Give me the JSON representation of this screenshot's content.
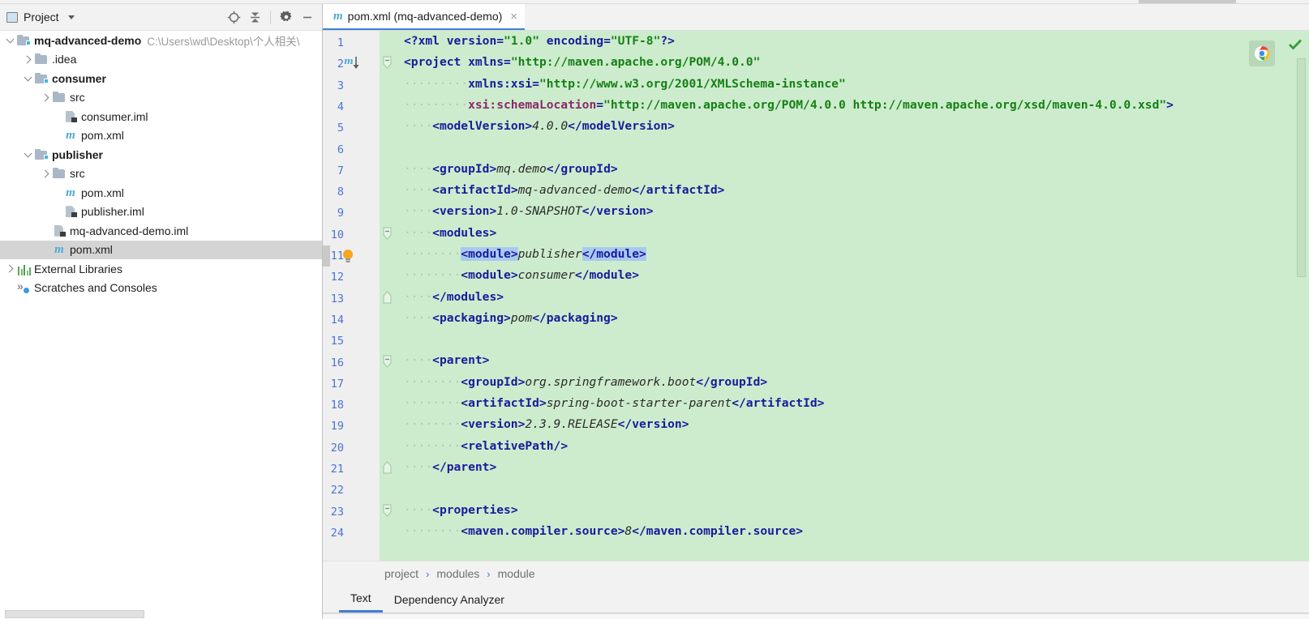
{
  "window": {
    "tool_window_title": "Project"
  },
  "toolbar": {
    "locate_icon": "locate-target-icon",
    "collapse_icon": "collapse-all-icon",
    "settings_icon": "gear-icon",
    "minimize_icon": "minimize-icon"
  },
  "project_tree": [
    {
      "label": "mq-advanced-demo",
      "path": "C:\\Users\\wd\\Desktop\\个人相关\\",
      "icon": "module-folder-icon",
      "twisty": "down",
      "indent": 0,
      "bold": true,
      "selected": false
    },
    {
      "label": ".idea",
      "path": "",
      "icon": "folder-icon",
      "twisty": "right",
      "indent": 1,
      "bold": false,
      "selected": false
    },
    {
      "label": "consumer",
      "path": "",
      "icon": "module-folder-icon",
      "twisty": "down",
      "indent": 1,
      "bold": true,
      "selected": false
    },
    {
      "label": "src",
      "path": "",
      "icon": "folder-icon",
      "twisty": "right",
      "indent": 2,
      "bold": false,
      "selected": false
    },
    {
      "label": "consumer.iml",
      "path": "",
      "icon": "iml-file-icon",
      "twisty": "none",
      "indent": 3,
      "bold": false,
      "selected": false
    },
    {
      "label": "pom.xml",
      "path": "",
      "icon": "maven-file-icon",
      "twisty": "none",
      "indent": 3,
      "bold": false,
      "selected": false
    },
    {
      "label": "publisher",
      "path": "",
      "icon": "module-folder-icon",
      "twisty": "down",
      "indent": 1,
      "bold": true,
      "selected": false
    },
    {
      "label": "src",
      "path": "",
      "icon": "folder-icon",
      "twisty": "right",
      "indent": 2,
      "bold": false,
      "selected": false
    },
    {
      "label": "pom.xml",
      "path": "",
      "icon": "maven-file-icon",
      "twisty": "none",
      "indent": 3,
      "bold": false,
      "selected": false
    },
    {
      "label": "publisher.iml",
      "path": "",
      "icon": "iml-file-icon",
      "twisty": "none",
      "indent": 3,
      "bold": false,
      "selected": false
    },
    {
      "label": "mq-advanced-demo.iml",
      "path": "",
      "icon": "iml-file-icon",
      "twisty": "none",
      "indent": 2,
      "bold": false,
      "selected": false
    },
    {
      "label": "pom.xml",
      "path": "",
      "icon": "maven-file-icon",
      "twisty": "none",
      "indent": 2,
      "bold": false,
      "selected": true
    },
    {
      "label": "External Libraries",
      "path": "",
      "icon": "libraries-icon",
      "twisty": "right",
      "indent": 0,
      "bold": false,
      "selected": false
    },
    {
      "label": "Scratches and Consoles",
      "path": "",
      "icon": "scratches-icon",
      "twisty": "none",
      "indent": 0,
      "bold": false,
      "selected": false
    }
  ],
  "editor_tabs": [
    {
      "label": "pom.xml (mq-advanced-demo)",
      "icon": "maven-file-icon",
      "close": "×",
      "active": true
    }
  ],
  "editor": {
    "first_line": 1,
    "last_line": 24,
    "line_numbers": [
      1,
      2,
      3,
      4,
      5,
      6,
      7,
      8,
      9,
      10,
      11,
      12,
      13,
      14,
      15,
      16,
      17,
      18,
      19,
      20,
      21,
      22,
      23,
      24
    ],
    "lines": [
      {
        "n": 1,
        "fold": "none",
        "segs": [
          {
            "t": "punct",
            "s": "<?"
          },
          {
            "t": "tag",
            "s": "xml"
          },
          {
            "t": "ws",
            "s": " "
          },
          {
            "t": "aname",
            "s": "version"
          },
          {
            "t": "punct",
            "s": "="
          },
          {
            "t": "aval",
            "s": "\"1.0\""
          },
          {
            "t": "ws",
            "s": " "
          },
          {
            "t": "aname",
            "s": "encoding"
          },
          {
            "t": "punct",
            "s": "="
          },
          {
            "t": "aval",
            "s": "\"UTF-8\""
          },
          {
            "t": "punct",
            "s": "?>"
          }
        ]
      },
      {
        "n": 2,
        "fold": "open",
        "gutter_icon": "maven-reimport-icon",
        "segs": [
          {
            "t": "punct",
            "s": "<"
          },
          {
            "t": "tag",
            "s": "project"
          },
          {
            "t": "ws",
            "s": " "
          },
          {
            "t": "aname",
            "s": "xmlns"
          },
          {
            "t": "punct",
            "s": "="
          },
          {
            "t": "aval",
            "s": "\"http://maven.apache.org/POM/4.0.0\""
          }
        ]
      },
      {
        "n": 3,
        "fold": "none",
        "indent_dots": 9,
        "pad": "         ",
        "segs": [
          {
            "t": "aname",
            "s": "xmlns:xsi"
          },
          {
            "t": "punct",
            "s": "="
          },
          {
            "t": "aval",
            "s": "\"http://www.w3.org/2001/XMLSchema-instance\""
          }
        ]
      },
      {
        "n": 4,
        "fold": "none",
        "indent_dots": 9,
        "pad": "         ",
        "segs": [
          {
            "t": "xsi",
            "s": "xsi:schemaLocation"
          },
          {
            "t": "punct",
            "s": "="
          },
          {
            "t": "aval",
            "s": "\"http://maven.apache.org/POM/4.0.0 http://maven.apache.org/xsd/maven-4.0.0.xsd\""
          },
          {
            "t": "punct",
            "s": ">"
          }
        ]
      },
      {
        "n": 5,
        "fold": "none",
        "pad": "    ",
        "segs": [
          {
            "t": "punct",
            "s": "<"
          },
          {
            "t": "tag",
            "s": "modelVersion"
          },
          {
            "t": "punct",
            "s": ">"
          },
          {
            "t": "txt",
            "s": "4.0.0"
          },
          {
            "t": "punct",
            "s": "</"
          },
          {
            "t": "tag",
            "s": "modelVersion"
          },
          {
            "t": "punct",
            "s": ">"
          }
        ]
      },
      {
        "n": 6,
        "fold": "none",
        "pad": "",
        "segs": []
      },
      {
        "n": 7,
        "fold": "none",
        "pad": "    ",
        "segs": [
          {
            "t": "punct",
            "s": "<"
          },
          {
            "t": "tag",
            "s": "groupId"
          },
          {
            "t": "punct",
            "s": ">"
          },
          {
            "t": "txt",
            "s": "mq.demo"
          },
          {
            "t": "punct",
            "s": "</"
          },
          {
            "t": "tag",
            "s": "groupId"
          },
          {
            "t": "punct",
            "s": ">"
          }
        ]
      },
      {
        "n": 8,
        "fold": "none",
        "pad": "    ",
        "segs": [
          {
            "t": "punct",
            "s": "<"
          },
          {
            "t": "tag",
            "s": "artifactId"
          },
          {
            "t": "punct",
            "s": ">"
          },
          {
            "t": "txt",
            "s": "mq-advanced-demo"
          },
          {
            "t": "punct",
            "s": "</"
          },
          {
            "t": "tag",
            "s": "artifactId"
          },
          {
            "t": "punct",
            "s": ">"
          }
        ]
      },
      {
        "n": 9,
        "fold": "none",
        "pad": "    ",
        "segs": [
          {
            "t": "punct",
            "s": "<"
          },
          {
            "t": "tag",
            "s": "version"
          },
          {
            "t": "punct",
            "s": ">"
          },
          {
            "t": "txt",
            "s": "1.0-SNAPSHOT"
          },
          {
            "t": "punct",
            "s": "</"
          },
          {
            "t": "tag",
            "s": "version"
          },
          {
            "t": "punct",
            "s": ">"
          }
        ]
      },
      {
        "n": 10,
        "fold": "open",
        "pad": "    ",
        "segs": [
          {
            "t": "punct",
            "s": "<"
          },
          {
            "t": "tag",
            "s": "modules"
          },
          {
            "t": "punct",
            "s": ">"
          }
        ]
      },
      {
        "n": 11,
        "fold": "none",
        "gutter_icon": "intention-bulb-icon",
        "selected_row": true,
        "pad": "        ",
        "segs": [
          {
            "t": "punct hl",
            "s": "<"
          },
          {
            "t": "tag hl",
            "s": "module"
          },
          {
            "t": "punct hl",
            "s": ">"
          },
          {
            "t": "txt",
            "s": "publisher"
          },
          {
            "t": "punct hl",
            "s": "</"
          },
          {
            "t": "tag hl",
            "s": "module"
          },
          {
            "t": "punct hl",
            "s": ">"
          }
        ]
      },
      {
        "n": 12,
        "fold": "none",
        "pad": "        ",
        "segs": [
          {
            "t": "punct",
            "s": "<"
          },
          {
            "t": "tag",
            "s": "module"
          },
          {
            "t": "punct",
            "s": ">"
          },
          {
            "t": "txt",
            "s": "consumer"
          },
          {
            "t": "punct",
            "s": "</"
          },
          {
            "t": "tag",
            "s": "module"
          },
          {
            "t": "punct",
            "s": ">"
          }
        ]
      },
      {
        "n": 13,
        "fold": "close",
        "pad": "    ",
        "segs": [
          {
            "t": "punct",
            "s": "</"
          },
          {
            "t": "tag",
            "s": "modules"
          },
          {
            "t": "punct",
            "s": ">"
          }
        ]
      },
      {
        "n": 14,
        "fold": "none",
        "pad": "    ",
        "segs": [
          {
            "t": "punct",
            "s": "<"
          },
          {
            "t": "tag",
            "s": "packaging"
          },
          {
            "t": "punct",
            "s": ">"
          },
          {
            "t": "txt",
            "s": "pom"
          },
          {
            "t": "punct",
            "s": "</"
          },
          {
            "t": "tag",
            "s": "packaging"
          },
          {
            "t": "punct",
            "s": ">"
          }
        ]
      },
      {
        "n": 15,
        "fold": "none",
        "pad": "",
        "segs": []
      },
      {
        "n": 16,
        "fold": "open",
        "pad": "    ",
        "segs": [
          {
            "t": "punct",
            "s": "<"
          },
          {
            "t": "tag",
            "s": "parent"
          },
          {
            "t": "punct",
            "s": ">"
          }
        ]
      },
      {
        "n": 17,
        "fold": "none",
        "pad": "        ",
        "segs": [
          {
            "t": "punct",
            "s": "<"
          },
          {
            "t": "tag",
            "s": "groupId"
          },
          {
            "t": "punct",
            "s": ">"
          },
          {
            "t": "txt",
            "s": "org.springframework.boot"
          },
          {
            "t": "punct",
            "s": "</"
          },
          {
            "t": "tag",
            "s": "groupId"
          },
          {
            "t": "punct",
            "s": ">"
          }
        ]
      },
      {
        "n": 18,
        "fold": "none",
        "pad": "        ",
        "segs": [
          {
            "t": "punct",
            "s": "<"
          },
          {
            "t": "tag",
            "s": "artifactId"
          },
          {
            "t": "punct",
            "s": ">"
          },
          {
            "t": "txt",
            "s": "spring-boot-starter-parent"
          },
          {
            "t": "punct",
            "s": "</"
          },
          {
            "t": "tag",
            "s": "artifactId"
          },
          {
            "t": "punct",
            "s": ">"
          }
        ]
      },
      {
        "n": 19,
        "fold": "none",
        "pad": "        ",
        "segs": [
          {
            "t": "punct",
            "s": "<"
          },
          {
            "t": "tag",
            "s": "version"
          },
          {
            "t": "punct",
            "s": ">"
          },
          {
            "t": "txt",
            "s": "2.3.9.RELEASE"
          },
          {
            "t": "punct",
            "s": "</"
          },
          {
            "t": "tag",
            "s": "version"
          },
          {
            "t": "punct",
            "s": ">"
          }
        ]
      },
      {
        "n": 20,
        "fold": "none",
        "pad": "        ",
        "segs": [
          {
            "t": "punct",
            "s": "<"
          },
          {
            "t": "tag",
            "s": "relativePath"
          },
          {
            "t": "punct",
            "s": "/>"
          }
        ]
      },
      {
        "n": 21,
        "fold": "close",
        "pad": "    ",
        "segs": [
          {
            "t": "punct",
            "s": "</"
          },
          {
            "t": "tag",
            "s": "parent"
          },
          {
            "t": "punct",
            "s": ">"
          }
        ]
      },
      {
        "n": 22,
        "fold": "none",
        "pad": "",
        "segs": []
      },
      {
        "n": 23,
        "fold": "open",
        "pad": "    ",
        "segs": [
          {
            "t": "punct",
            "s": "<"
          },
          {
            "t": "tag",
            "s": "properties"
          },
          {
            "t": "punct",
            "s": ">"
          }
        ]
      },
      {
        "n": 24,
        "fold": "none",
        "pad": "        ",
        "segs": [
          {
            "t": "punct",
            "s": "<"
          },
          {
            "t": "tag",
            "s": "maven.compiler.source"
          },
          {
            "t": "punct",
            "s": ">"
          },
          {
            "t": "txt",
            "s": "8"
          },
          {
            "t": "punct",
            "s": "</"
          },
          {
            "t": "tag",
            "s": "maven.compiler.source"
          },
          {
            "t": "punct",
            "s": ">"
          }
        ]
      }
    ]
  },
  "editor_overlay": {
    "browser_preview_icon": "chrome-browser-icon",
    "inspection_status_icon": "inspection-ok-check-icon"
  },
  "breadcrumb": {
    "items": [
      "project",
      "modules",
      "module"
    ],
    "separator": "›"
  },
  "bottom_tabs": [
    {
      "label": "Text",
      "active": true
    },
    {
      "label": "Dependency Analyzer",
      "active": false
    }
  ],
  "colors": {
    "editor_background": "#cdeccd",
    "gutter_background": "#efefef",
    "line_number": "#4a74d4",
    "tag": "#1a1a9c",
    "attr_value": "#168016",
    "text_value": "#2b2b2b",
    "xsi_attr": "#8b2a6b",
    "match_highlight": "#a8c9f0",
    "tab_underline": "#3f7fd6",
    "selection": "#d4d4d4"
  }
}
